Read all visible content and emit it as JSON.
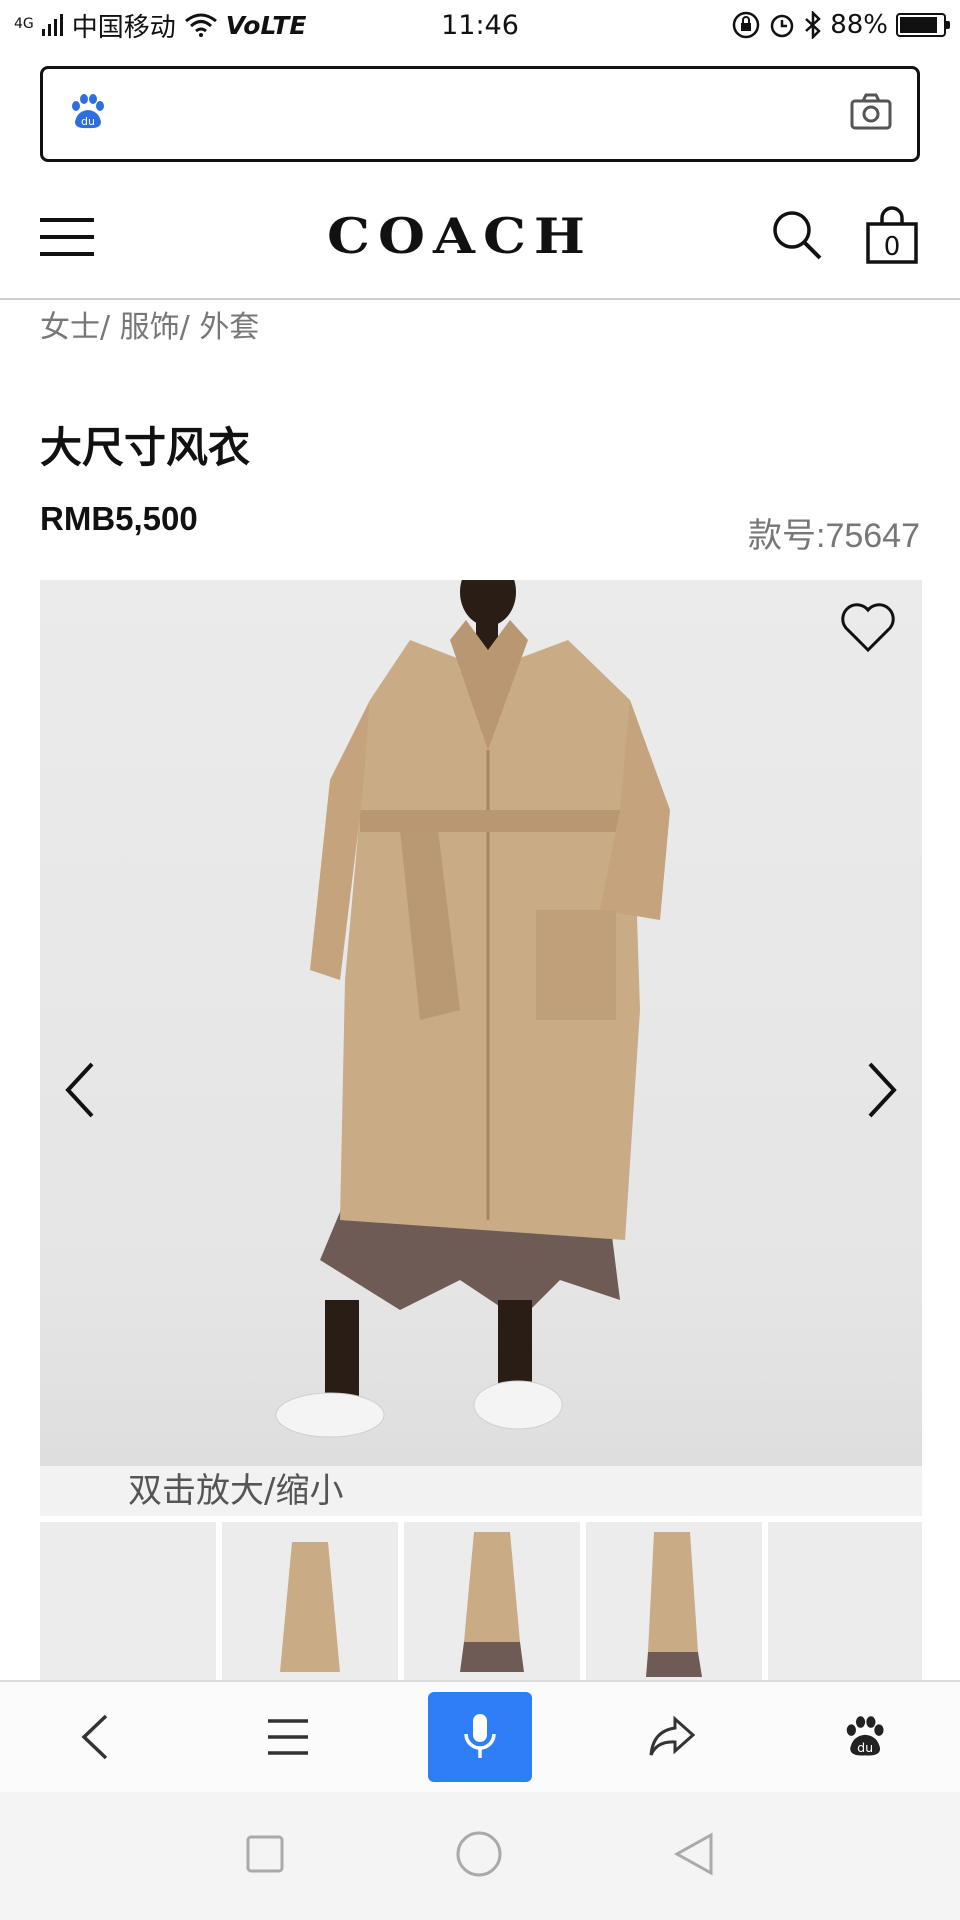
{
  "status_bar": {
    "network": "4G",
    "carrier": "中国移动",
    "volte": "VoLTE",
    "time": "11:46",
    "battery": "88%",
    "battery_level": 0.88
  },
  "browser": {
    "search_placeholder": "",
    "logo_icon": "baidu-paw-icon",
    "camera_icon": "camera-icon"
  },
  "site": {
    "logo": "COACH",
    "bag_count": "0"
  },
  "breadcrumb": {
    "items": [
      "女士",
      "服饰",
      "外套"
    ],
    "separator": "/ "
  },
  "product": {
    "title": "大尺寸风衣",
    "price": "RMB5,500",
    "sku": "款号:75647",
    "zoom_hint": "双击放大/缩小"
  },
  "colors": {
    "accent": "#2e7ff7",
    "coat": "#c9ab86",
    "background": "#ebebeb"
  },
  "toolbar": {
    "items": [
      "back-icon",
      "menu-icon",
      "microphone-icon",
      "share-icon",
      "baidu-paw-icon"
    ]
  },
  "android_nav": {
    "items": [
      "recents-square-icon",
      "home-circle-icon",
      "back-triangle-icon"
    ]
  }
}
